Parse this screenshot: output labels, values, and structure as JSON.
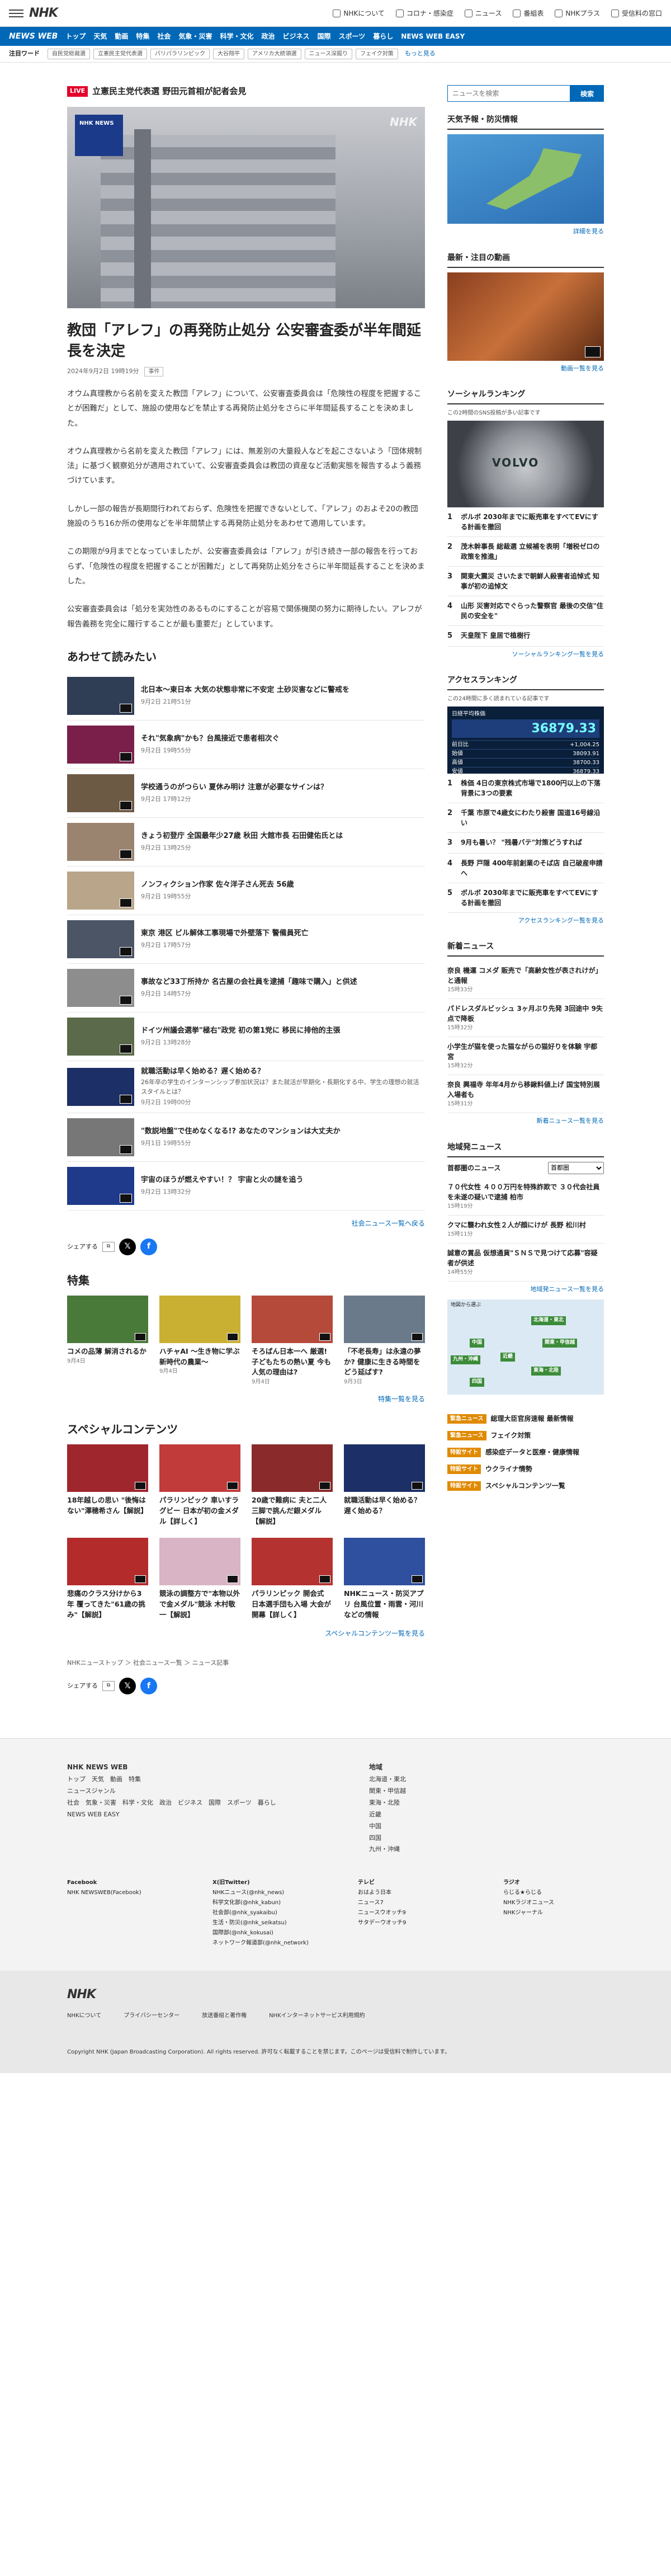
{
  "header": {
    "logo": "NHK",
    "links": [
      "NHKについて",
      "コロナ・感染症",
      "ニュース",
      "番組表",
      "NHKプラス",
      "受信料の窓口"
    ]
  },
  "nav": {
    "brand": "NEWS WEB",
    "items": [
      "トップ",
      "天気",
      "動画",
      "特集",
      "社会",
      "気象・災害",
      "科学・文化",
      "政治",
      "ビジネス",
      "国際",
      "スポーツ",
      "暮らし",
      "NEWS WEB EASY"
    ]
  },
  "keywords": {
    "label": "注目ワード",
    "items": [
      "自民党総裁選",
      "立憲民主党代表選",
      "パリパラリンピック",
      "大谷翔平",
      "アメリカ大統領選",
      "ニュース深掘り",
      "フェイク対策"
    ],
    "more": "もっと見る"
  },
  "live": {
    "badge": "LIVE",
    "text": "立憲民主党代表選 野田元首相が記者会見"
  },
  "hero": {
    "logo_text": "NHK NEWS",
    "watermark": "NHK"
  },
  "article": {
    "title": "教団「アレフ」の再発防止処分 公安審査委が半年間延長を決定",
    "date": "2024年9月2日 19時19分",
    "tag": "事件",
    "paragraphs": [
      "オウム真理教から名前を変えた教団「アレフ」について、公安審査委員会は「危険性の程度を把握することが困難だ」として、施設の使用などを禁止する再発防止処分をさらに半年間延長することを決めました。",
      "オウム真理教から名前を変えた教団「アレフ」には、無差別の大量殺人などを起こさないよう「団体規制法」に基づく観察処分が適用されていて、公安審査委員会は教団の資産など活動実態を報告するよう義務づけています。",
      "しかし一部の報告が長期間行われておらず、危険性を把握できないとして、「アレフ」のおよそ20の教団施設のうち16か所の使用などを半年間禁止する再発防止処分をあわせて適用しています。",
      "この期限が9月までとなっていましたが、公安審査委員会は「アレフ」が引き続き一部の報告を行っておらず、「危険性の程度を把握することが困難だ」として再発防止処分をさらに半年間延長することを決めました。",
      "公安審査委員会は「処分を実効性のあるものにすることが容易で関係機関の努力に期待したい。アレフが報告義務を完全に履行することが最も重要だ」としています。"
    ]
  },
  "related": {
    "heading": "あわせて読みたい",
    "items": [
      {
        "title": "北日本～東日本 大気の状態非常に不安定 土砂災害などに警戒を",
        "date": "9月2日 21時51分",
        "color": "#2f3e55"
      },
      {
        "title": "それ\"気象病\"かも？台風接近で患者相次ぐ",
        "date": "9月2日 19時55分",
        "color": "#7a1f4a"
      },
      {
        "title": "学校通うのがつらい 夏休み明け 注意が必要なサインは？",
        "date": "9月2日 17時12分",
        "color": "#6d5a45"
      },
      {
        "title": "きょう初登庁 全国最年少27歳 秋田 大館市長 石田健佑氏とは",
        "date": "9月2日 13時25分",
        "color": "#9a8470"
      },
      {
        "title": "ノンフィクション作家 佐々洋子さん死去 56歳",
        "date": "9月2日 19時55分",
        "color": "#b8a58a"
      },
      {
        "title": "東京 港区 ビル解体工事現場で外壁落下 警備員死亡",
        "date": "9月2日 17時57分",
        "color": "#4b5566"
      },
      {
        "title": "事故など33丁所持か 名古屋の会社員を逮捕「趣味で購入」と供述",
        "date": "9月2日 14時57分",
        "color": "#8d8d8d"
      },
      {
        "title": "ドイツ州議会選挙\"極右\"政党 初の第1党に 移民に排他的主張",
        "date": "9月2日 13時28分",
        "color": "#5a6a4a"
      },
      {
        "title": "就職活動は早く始める？遅く始める？",
        "desc": "26年卒の学生のインターンシップ参加状況は？また就活が早期化・長期化する中、学生の理想の就活スタイルとは？",
        "date": "9月2日 19時00分",
        "color": "#1c2f66"
      },
      {
        "title": "\"数説地盤\"で住めなくなる!? あなたのマンションは大丈夫か",
        "date": "9月1日 19時55分",
        "color": "#777"
      },
      {
        "title": "宇宙のほうが燃えやすい！？ 宇宙と火の謎を追う",
        "date": "9月2日 13時32分",
        "color": "#1f3a8a"
      }
    ],
    "more": "社会ニュース一覧へ戻る"
  },
  "share": {
    "label": "シェアする"
  },
  "feature": {
    "heading": "特集",
    "items": [
      {
        "title": "コメの品薄 解消されるか",
        "date": "9月4日",
        "color": "#4a7a3a"
      },
      {
        "title": "ハチャAI ～生き物に学ぶ新時代の農業～",
        "date": "9月4日",
        "color": "#c9b032"
      },
      {
        "title": "そろばん日本一へ 厳選!子どもたちの熱い夏 今も人気の理由は?",
        "date": "9月4日",
        "color": "#b54a3a"
      },
      {
        "title": "「不老長寿」は永遠の夢か? 健康に生きる時間をどう延ばす?",
        "date": "9月3日",
        "color": "#6a7a8a"
      }
    ],
    "more": "特集一覧を見る"
  },
  "special": {
    "heading": "スペシャルコンテンツ",
    "items": [
      {
        "title": "18年越しの思い \"後悔はない\"澤穂希さん【解説】",
        "color": "#a0262e"
      },
      {
        "title": "パラリンピック 車いすラグビー 日本が初の金メダル【詳しく】",
        "color": "#c23b3b"
      },
      {
        "title": "20歳で難病に 夫と二人三脚で挑んだ銀メダル【解説】",
        "color": "#8a2a2a"
      },
      {
        "title": "就職活動は早く始める？遅く始める？",
        "color": "#1c2f66"
      },
      {
        "title": "悲痛のクラス分けから3年 覆ってきた\"61歳の挑み\"【解説】",
        "color": "#b32b2b"
      },
      {
        "title": "競泳の調整方で\"本物以外で金メダル\"競泳 木村敬一【解説】",
        "color": "#d8b4c4"
      },
      {
        "title": "パラリンピック 開会式 日本選手団も入場 大会が開幕【詳しく】",
        "color": "#b4322f"
      },
      {
        "title": "NHKニュース・防災アプリ 台風位置・雨雲・河川などの情報",
        "color": "#2f4f9f"
      }
    ],
    "more": "スペシャルコンテンツ一覧を見る"
  },
  "breadcrumb": [
    "NHKニューストップ",
    "社会ニュース一覧",
    "ニュース記事"
  ],
  "sidebar": {
    "search": {
      "placeholder": "ニュースを検索",
      "button": "検索"
    },
    "weather": {
      "heading": "天気予報・防災情報",
      "more": "詳細を見る"
    },
    "video": {
      "heading": "最新・注目の動画",
      "more": "動画一覧を見る"
    },
    "social": {
      "heading": "ソーシャルランキング",
      "sub": "この2時間のSNS投稿が多い記事です",
      "image_text": "VOLVO",
      "items": [
        "ボルボ 2030年までに販売車をすべてEVにする計画を撤回",
        "茂木幹事長 総裁選 立候補を表明「増税ゼロの政策を推進」",
        "関東大震災 さいたまで朝鮮人殺害者追悼式 知事が初の追悼文",
        "山形 災害対応でぐらった警察官 最後の交信\"住民の安全を\"",
        "天皇陛下 皇居で植樹行"
      ],
      "more": "ソーシャルランキング一覧を見る"
    },
    "access": {
      "heading": "アクセスランキング",
      "sub": "この24時間に多く読まれている記事です",
      "chart_title": "日経平均株価",
      "chart_value": "36879.33",
      "rows": [
        [
          "前日比",
          "+1,004.25"
        ],
        [
          "始値",
          "38093.91"
        ],
        [
          "高値",
          "38700.33"
        ],
        [
          "安値",
          "36879.33"
        ]
      ],
      "items": [
        "株価 4日の東京株式市場で1800円以上の下落 背景に3つの要素",
        "千葉 市原で4歳女にわたり殺害 国道16号線沿い",
        "9月も暑い？ \"残暑バテ\"対策どうすれば",
        "長野 戸隠 400年前創業のそば店 自己破産申請へ",
        "ボルボ 2030年までに販売車をすべてEVにする計画を撤回"
      ],
      "more": "アクセスランキング一覧を見る"
    },
    "latest": {
      "heading": "新着ニュース",
      "items": [
        {
          "t": "奈良 機運 コメダ 販売で「高齢女性が表されけが」と通報",
          "d": "15時33分"
        },
        {
          "t": "パドレスダルビッシュ 3ヶ月ぶり先発 3回途中 9失点で降板",
          "d": "15時32分"
        },
        {
          "t": "小学生が猫を使った猫ながらの猫好りを体験 宇都宮",
          "d": "15時32分"
        },
        {
          "t": "奈良 興福寺 年年4月から移鍬料値上げ 国宝特別展入場者も",
          "d": "15時31分"
        }
      ],
      "more": "新着ニュース一覧を見る"
    },
    "local": {
      "heading": "地域発ニュース",
      "label": "首都圏のニュース",
      "select": "首都圏",
      "items": [
        {
          "t": "７０代女性 ４００万円を特殊詐欺で ３０代会社員を未遂の疑いで逮捕 柏市",
          "d": "15時19分"
        },
        {
          "t": "クマに襲われ女性２人が顔にけが 長野 松川村",
          "d": "15時11分"
        },
        {
          "t": "誠意の賞品 仮想通貨\"ＳＮＳで見つけて応募\"容疑者が供述",
          "d": "14時55分"
        }
      ],
      "more": "地域発ニュース一覧を見る",
      "map_caption": "地図から選ぶ",
      "regions": [
        "北海道・東北",
        "関東・甲信越",
        "東海・北陸",
        "近畿",
        "中国",
        "四国",
        "九州・沖縄"
      ]
    },
    "promos": [
      {
        "l": "緊急ニュース",
        "t": "総理大臣官房速報 最新情報"
      },
      {
        "l": "緊急ニュース",
        "t": "フェイク対策"
      },
      {
        "l": "特設サイト",
        "t": "感染症データと医療・健康情報"
      },
      {
        "l": "特設サイト",
        "t": "ウクライナ情勢"
      },
      {
        "l": "特設サイト",
        "t": "スペシャルコンテンツ一覧"
      }
    ]
  },
  "footer": {
    "col1_title": "NHK NEWS WEB",
    "col1": [
      "トップ",
      "天気",
      "動画",
      "特集",
      "ニュースジャンル",
      "社会",
      "気象・災害",
      "科学・文化",
      "政治",
      "ビジネス",
      "国際",
      "スポーツ",
      "暮らし",
      "NEWS WEB EASY"
    ],
    "col2_title": "地域",
    "col2": [
      "北海道・東北",
      "関東・甲信越",
      "東海・北陸",
      "近畿",
      "中国",
      "四国",
      "九州・沖縄"
    ],
    "social": [
      [
        "Facebook",
        "NHK NEWSWEB(Facebook)"
      ],
      [
        "X(旧Twitter)",
        "NHKニュース(@nhk_news)",
        "科学文化部(@nhk_kabun)",
        "社会部(@nhk_syakaibu)",
        "生活・防災(@nhk_seikatsu)",
        "国際部(@nhk_kokusai)",
        "ネットワーク報道部(@nhk_network)"
      ],
      [
        "テレビ",
        "おはよう日本",
        "ニュース7",
        "ニュースウオッチ9",
        "サタデーウオッチ9"
      ],
      [
        "ラジオ",
        "らじる★らじる",
        "NHKラジオニュース",
        "NHKジャーナル"
      ]
    ],
    "bottom_links": [
      "NHKについて",
      "プライバシーセンター",
      "放送番組と著作権",
      "NHKインターネットサービス利用規約"
    ],
    "copyright": "Copyright NHK (Japan Broadcasting Corporation). All rights reserved. 許可なく転載することを禁じます。このページは受信料で制作しています。"
  }
}
